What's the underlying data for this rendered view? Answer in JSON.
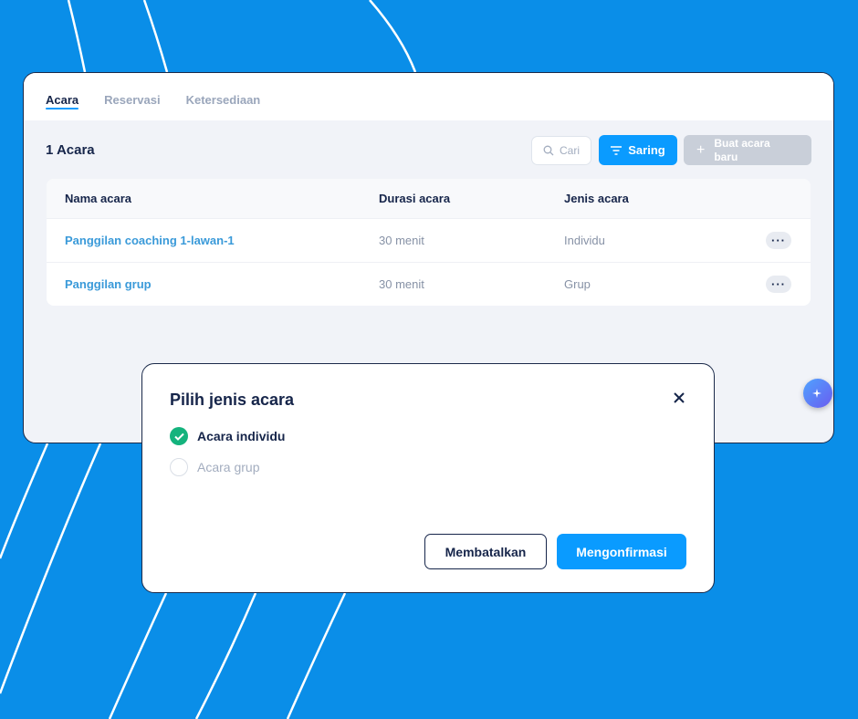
{
  "tabs": [
    {
      "label": "Acara",
      "active": true
    },
    {
      "label": "Reservasi",
      "active": false
    },
    {
      "label": "Ketersediaan",
      "active": false
    }
  ],
  "toolbar": {
    "count_label": "1 Acara",
    "search_placeholder": "Cari",
    "filter_label": "Saring",
    "create_label": "Buat acara baru"
  },
  "table": {
    "headers": [
      "Nama acara",
      "Durasi acara",
      "Jenis acara"
    ],
    "rows": [
      {
        "name": "Panggilan coaching 1-lawan-1",
        "duration": "30 menit",
        "type": "Individu",
        "more": "···"
      },
      {
        "name": "Panggilan grup",
        "duration": "30 menit",
        "type": "Grup",
        "more": "···"
      }
    ]
  },
  "modal": {
    "title": "Pilih jenis acara",
    "options": [
      {
        "label": "Acara individu",
        "selected": true
      },
      {
        "label": "Acara grup",
        "selected": false
      }
    ],
    "cancel_label": "Membatalkan",
    "confirm_label": "Mengonfirmasi"
  },
  "colors": {
    "background": "#0a8ee8",
    "accent": "#0a9bff",
    "primary_text": "#16254a",
    "link": "#3a9ad9",
    "success": "#14b37d"
  }
}
